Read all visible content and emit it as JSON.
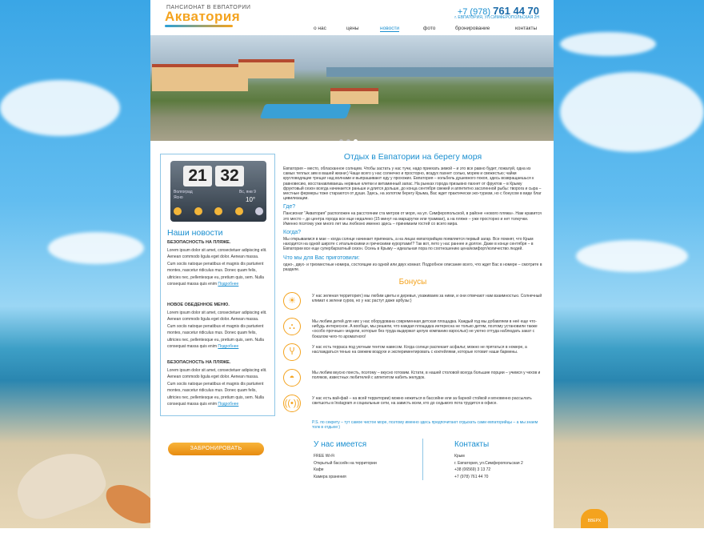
{
  "brand": {
    "tagline": "ПАНСИОНАТ В ЕВПАТОРИИ",
    "name": "Акватория"
  },
  "contact_header": {
    "phone_prefix": "+7 (978)",
    "phone_number": "761 44 70",
    "address": "г. ЕВПАТОРИЯ, УЛ.СИМФЕРОПОЛЬСКАЯ 2Н"
  },
  "nav": [
    {
      "label": "о нас"
    },
    {
      "label": "цены"
    },
    {
      "label": "новости",
      "active": true
    },
    {
      "label": "фото"
    },
    {
      "label": "бронирование"
    },
    {
      "label": "контакты"
    }
  ],
  "slider": {
    "slides": 3,
    "active": 3
  },
  "widget": {
    "hours": "21",
    "minutes": "32",
    "city": "Волгоград",
    "condition": "Ясно",
    "date": "Вс, янв 9",
    "temp": "10°"
  },
  "news": {
    "title": "Наши новости",
    "items": [
      {
        "heading": "БЕЗОПАСНОСТЬ НА ПЛЯЖЕ.",
        "body": "Lorem ipsum dolor sit amet, consectetuer adipiscing elit. Aenean commodo ligula eget dolor. Aenean massa. Cum sociis natoque penatibus et magnis dis parturient montes, nascetur ridiculus mus. Donec quam felis, ultricies nec, pellentesque eu, pretium quis, sem. Nulla consequat massa quis enim",
        "more": "Подробнее"
      },
      {
        "heading": "НОВОЕ ОБЕДЕННОЕ МЕНЮ.",
        "body": "Lorem ipsum dolor sit amet, consectetuer adipiscing elit. Aenean commodo ligula eget dolor. Aenean massa. Cum sociis natoque penatibus et magnis dis parturient montes, nascetur ridiculus mus. Donec quam felis, ultricies nec, pellentesque eu, pretium quis, sem. Nulla consequat massa quis enim",
        "more": "Подробнее"
      },
      {
        "heading": "БЕЗОПАСНОСТЬ НА ПЛЯЖЕ.",
        "body": "Lorem ipsum dolor sit amet, consectetuer adipiscing elit. Aenean commodo ligula eget dolor. Aenean massa. Cum sociis natoque penatibus et magnis dis parturient montes, nascetur ridiculus mus. Donec quam felis, ultricies nec, pellentesque eu, pretium quis, sem. Nulla consequat massa quis enim",
        "more": "Подробнее"
      }
    ]
  },
  "main": {
    "title": "Отдых в Евпатории на берегу моря",
    "intro": "Евпатория – место, обласканное солнцем. Чтобы застать у нас тучи, надо приехать зимой – и это все равно будет, пожалуй, одна из самых теплых зим в вашей жизни:) Чаще всего у нас солнечно и просторно, воздух пахнет солью, морем и свежестью; чайки кругловодящие трещат над волнами и выпрашивают еду у прохожих. Евпатория – кольбель душевного покоя, здесь возвращаешься к равновесию, восстанавливаешь нервные клетки и витаминный запас. На рынках города призывно пахнет от фруктов – в Крыму фруктовый сезон всегда начинается раньше и длится дольше, до конца сентября свежей и аппетитно засоленной рыбы: творога и сыра – местные фермеры тоже стараются от души. Здесь, на золотом берегу Крыма, Вас ждет практически эко-туризм, но с бонусом в виде благ цивилизации.",
    "sections": [
      {
        "heading": "Где?",
        "text": "Пансионат \"Акватория\" расположен на расстоянии ста метров от моря, на ул. Симферопольской, в районе «нового пляжа». Нам нравится это место – до центра города все еще недалеко (15 минут на маршрутке или трамвае), а на пляже – уже просторно и нет толкучки. Именно поэтому уже много лет мы любезно именно здесь – принимаем гостей со всего мира."
      },
      {
        "heading": "Когда?",
        "text": "Мы открываемся в мае – когда солнце начинает припекать, а на лицах евпаторийцев появляется первый загар. Все помнят, что Крым находится на одной широте с итальянскими и греческими курортами!? Так вот, лето у нас раннее и долгое. Даже в конце сентября – в Евпатории все еще супербархатный сезон. Осень в Крыму – идеальная пора по соотношению цена/комфорт/количество людей."
      },
      {
        "heading": "Что мы для Вас приготовили:",
        "text": "одно-, двух- и трехместные номера, состоящие из одной или двух комнат. Подробное описание всего, что ждет Вас в номере – смотрите в разделе."
      }
    ],
    "bonus_title": "Бонусы",
    "bonuses": [
      {
        "icon": "sun-icon",
        "text": "У нас зеленая территория:) мы любим цветы и деревья, ухаживаем за ними, и они отвечают нам взаимностью. Солнечный климат к зелени суров, но у нас растут даже арбузы:)"
      },
      {
        "icon": "playground-icon",
        "text": "Мы любим детей для них у нас оборудована современная детская площадка. Каждый год мы добавляем в неё еще что-нибудь интересное. А вообще, мы решили, что каждая площадка интересна не только детям, поэтому установили также «особо прочные» модели, которые без труда выдержат целую компанию взрослых) не уютно оттуда наблюдать закат с бокалом чего-то ароматного!"
      },
      {
        "icon": "cocktail-icon",
        "text": "У нас есть терраса под уютным тентом навесом. Когда солнце распекает асфальт, можно не прятаться в номере, а наслаждаться тенью на свежем воздухе и экспериментировать с коктейлями, которые готовит наши бармены."
      },
      {
        "icon": "dish-icon",
        "text": "Мы любим вкусно поесть, поэтому – вкусно готовим. Кстати, в нашей столовой всегда большие порции – учимся у чехов и поляков, известных любителей с аппетитом набить желудок."
      },
      {
        "icon": "wifi-icon",
        "text": "У нас есть вай-фай – на всей территории) можно нежиться в бассейне или за барной стойкой и мгновенно рассылать свитшоты в Instagram и социальные сети, на зависть всем, кто до седьмого пота трудится в офисе."
      }
    ],
    "ps": "P.S. по секрету – тут самое чистое море, поэтому именно здесь предпочитают отдыхать сами евпаторийцы – а мы знаем толк в отдыхе:)"
  },
  "footer": {
    "book_label": "ЗАБРОНИРОВАТЬ",
    "amenities_title": "У нас имеется",
    "amenities": [
      "FREE Wi-Fi",
      "Открытый бассейн на территории",
      "Кафе",
      "Камера хранения"
    ],
    "contacts_title": "Контакты",
    "contacts": [
      "Крым",
      "г. Евпатория, ул.Симферопольская 2",
      "+38 (06569) 3 13 72",
      "+7 (978) 761 44 70"
    ]
  },
  "up_label": "ВВЕРХ"
}
